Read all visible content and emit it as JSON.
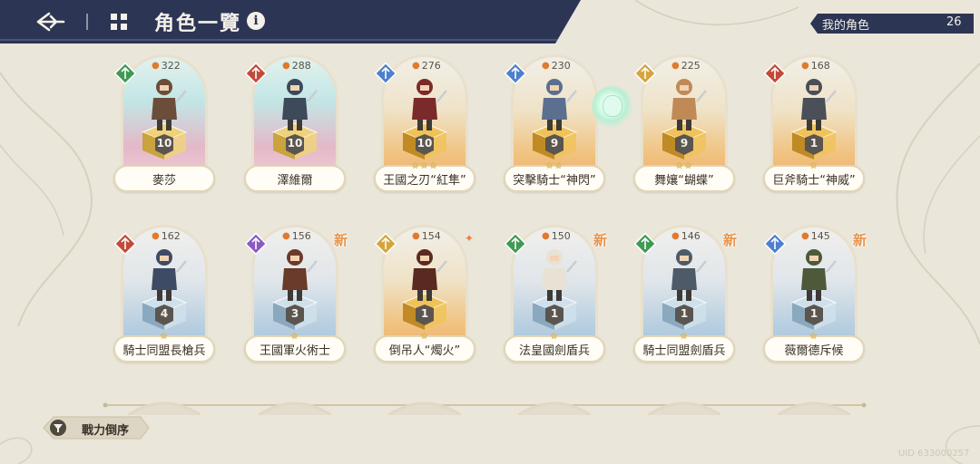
{
  "header": {
    "title": "角色一覽",
    "info_label": "i",
    "back_icon": "back-arrow-icon",
    "grid_icon": "grid-icon",
    "count_label": "我的角色",
    "count_value": "26",
    "bar_color": "#2c3553"
  },
  "characters": [
    {
      "name": "麥莎",
      "power": "322",
      "level": "10",
      "stars": "",
      "element": "green",
      "rarity": "pink",
      "new": false
    },
    {
      "name": "澤維爾",
      "power": "288",
      "level": "10",
      "stars": "",
      "element": "red",
      "rarity": "pink",
      "new": false
    },
    {
      "name": "王國之刃“紅隼”",
      "power": "276",
      "level": "10",
      "stars": "★★★",
      "element": "blue",
      "rarity": "orange",
      "new": false
    },
    {
      "name": "突擊騎士“神閃”",
      "power": "230",
      "level": "9",
      "stars": "★★",
      "element": "blue",
      "rarity": "orange",
      "new": false
    },
    {
      "name": "舞孃“蝴蝶”",
      "power": "225",
      "level": "9",
      "stars": "★★",
      "element": "yellow",
      "rarity": "orange",
      "new": false
    },
    {
      "name": "巨斧騎士“神威”",
      "power": "168",
      "level": "1",
      "stars": "★",
      "element": "red",
      "rarity": "orange",
      "new": false
    },
    {
      "name": "騎士同盟長槍兵",
      "power": "162",
      "level": "4",
      "stars": "★",
      "element": "red",
      "rarity": "blue",
      "new": false
    },
    {
      "name": "王國軍火術士",
      "power": "156",
      "level": "3",
      "stars": "★",
      "element": "purple",
      "rarity": "blue",
      "new": true
    },
    {
      "name": "倒吊人“燭火”",
      "power": "154",
      "level": "1",
      "stars": "★",
      "element": "yellow",
      "rarity": "orange",
      "new": false,
      "spark": true
    },
    {
      "name": "法皇國劍盾兵",
      "power": "150",
      "level": "1",
      "stars": "★",
      "element": "green",
      "rarity": "blue",
      "new": true
    },
    {
      "name": "騎士同盟劍盾兵",
      "power": "146",
      "level": "1",
      "stars": "★",
      "element": "green",
      "rarity": "blue",
      "new": true
    },
    {
      "name": "薇爾德斥候",
      "power": "145",
      "level": "1",
      "stars": "★",
      "element": "blue",
      "rarity": "blue",
      "new": true
    }
  ],
  "new_badge_label": "新",
  "sort": {
    "label": "戰力倒序",
    "icon": "filter-icon"
  },
  "uid": "UID 633000257",
  "element_colors": {
    "green": "#3f9a52",
    "red": "#c24a38",
    "blue": "#4c7fcf",
    "yellow": "#d6a43a",
    "purple": "#8a5ac4"
  }
}
